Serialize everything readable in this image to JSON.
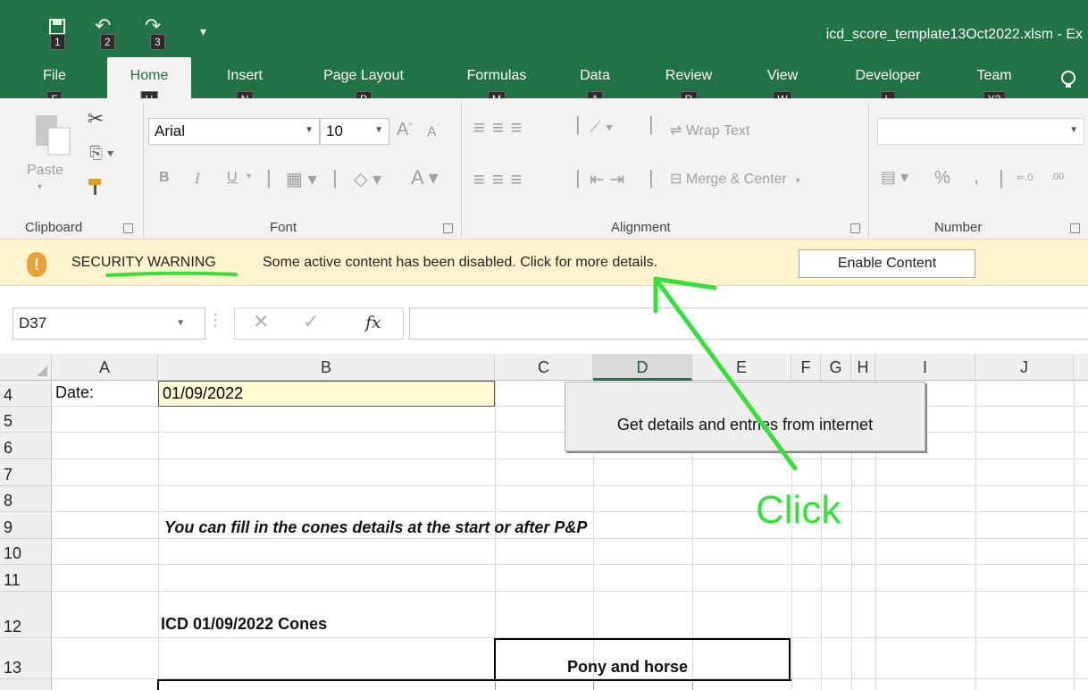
{
  "quick_access": {
    "keytips": [
      "1",
      "2",
      "3"
    ]
  },
  "window": {
    "title": "icd_score_template13Oct2022.xlsm - Ex"
  },
  "ribbon_tabs": [
    {
      "label": "File",
      "keytip": "F"
    },
    {
      "label": "Home",
      "keytip": "H",
      "active": true
    },
    {
      "label": "Insert",
      "keytip": "N"
    },
    {
      "label": "Page Layout",
      "keytip": "P"
    },
    {
      "label": "Formulas",
      "keytip": "M"
    },
    {
      "label": "Data",
      "keytip": "A"
    },
    {
      "label": "Review",
      "keytip": "R"
    },
    {
      "label": "View",
      "keytip": "W"
    },
    {
      "label": "Developer",
      "keytip": "L"
    },
    {
      "label": "Team",
      "keytip": "Y2"
    }
  ],
  "ribbon": {
    "clipboard": {
      "paste_label": "Paste",
      "group_label": "Clipboard"
    },
    "font": {
      "font_name": "Arial",
      "font_size": "10",
      "bold": "B",
      "italic": "I",
      "underline": "U",
      "group_label": "Font"
    },
    "alignment": {
      "wrap_text": "Wrap Text",
      "merge_center": "Merge & Center",
      "group_label": "Alignment"
    },
    "number": {
      "percent": "%",
      "comma": ",",
      "group_label": "Number"
    }
  },
  "security_bar": {
    "title": "SECURITY WARNING",
    "message": "Some active content has been disabled. Click for more details.",
    "button": "Enable Content"
  },
  "formula_bar": {
    "name_box": "D37",
    "fx": "fx",
    "formula": ""
  },
  "sheet": {
    "columns": [
      "A",
      "B",
      "C",
      "D",
      "E",
      "F",
      "G",
      "H",
      "I",
      "J"
    ],
    "selected_column": "D",
    "rows": [
      "4",
      "5",
      "6",
      "7",
      "8",
      "9",
      "10",
      "11",
      "12",
      "13"
    ],
    "cells": {
      "A4": "Date:",
      "B4": "01/09/2022",
      "B9": "You can fill in the cones details at the start or after P&P",
      "B12": "ICD  01/09/2022 Cones",
      "C13": "Pony and horse"
    },
    "macro_button": "Get details and entries from internet"
  },
  "annotation": {
    "label": "Click",
    "color": "#36e03a"
  },
  "colors": {
    "excel_green": "#217346",
    "ribbon_bg": "#f3f2f1",
    "warning_bg": "#fff4ce",
    "input_cell_bg": "#fffbd4"
  }
}
